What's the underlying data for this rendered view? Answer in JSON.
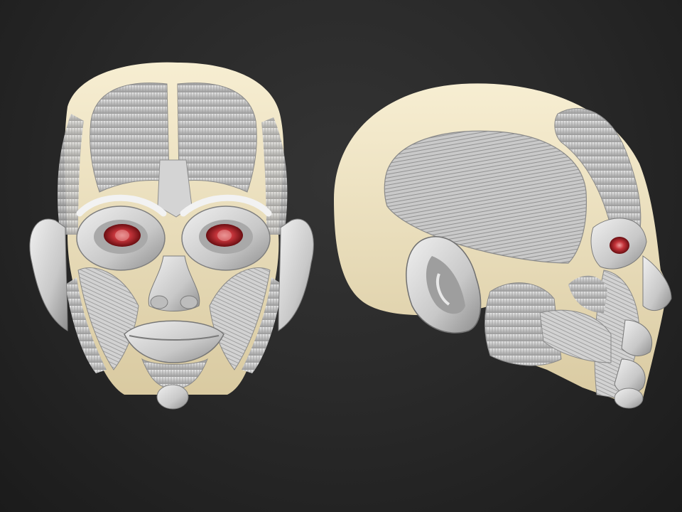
{
  "scene": {
    "subject": "",
    "views": [
      {
        "id": "front"
      },
      {
        "id": "side"
      }
    ]
  },
  "colors": {
    "background_top": "#343434",
    "background_bottom": "#1b1b1b",
    "skull": "#efe3bf",
    "skull_shadow": "#cdbf98",
    "muscle": "#cfcfcf",
    "muscle_shadow": "#8f8f8f",
    "muscle_highlight": "#f2f2f2",
    "eye": "#b3262a"
  }
}
